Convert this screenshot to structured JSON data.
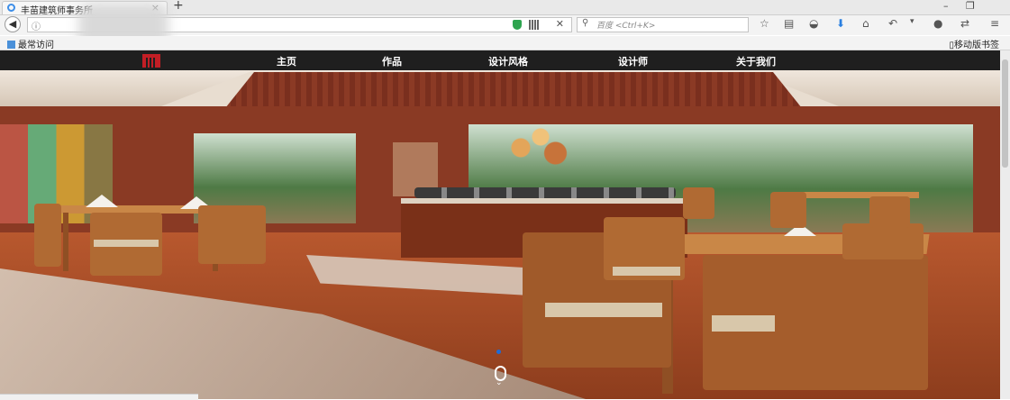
{
  "browser": {
    "tab": {
      "title": "丰苗建筑师事务所",
      "close": "×"
    },
    "new_tab": "+",
    "window_controls": {
      "minimize": "–",
      "restore": "❐"
    },
    "url_info": "ⓘ",
    "search_placeholder": "百度 <Ctrl+K>",
    "bookmarks": {
      "frequent": "最常访问",
      "mobile": "移动版书签"
    }
  },
  "site": {
    "nav": [
      "主页",
      "作品",
      "设计风格",
      "设计师",
      "关于我们"
    ],
    "slider": {
      "active_slide": 1
    }
  },
  "colors": {
    "nav_bg": "#1f1f1f",
    "logo_red": "#c21e25",
    "slider_dot": "#1f6bd6"
  }
}
